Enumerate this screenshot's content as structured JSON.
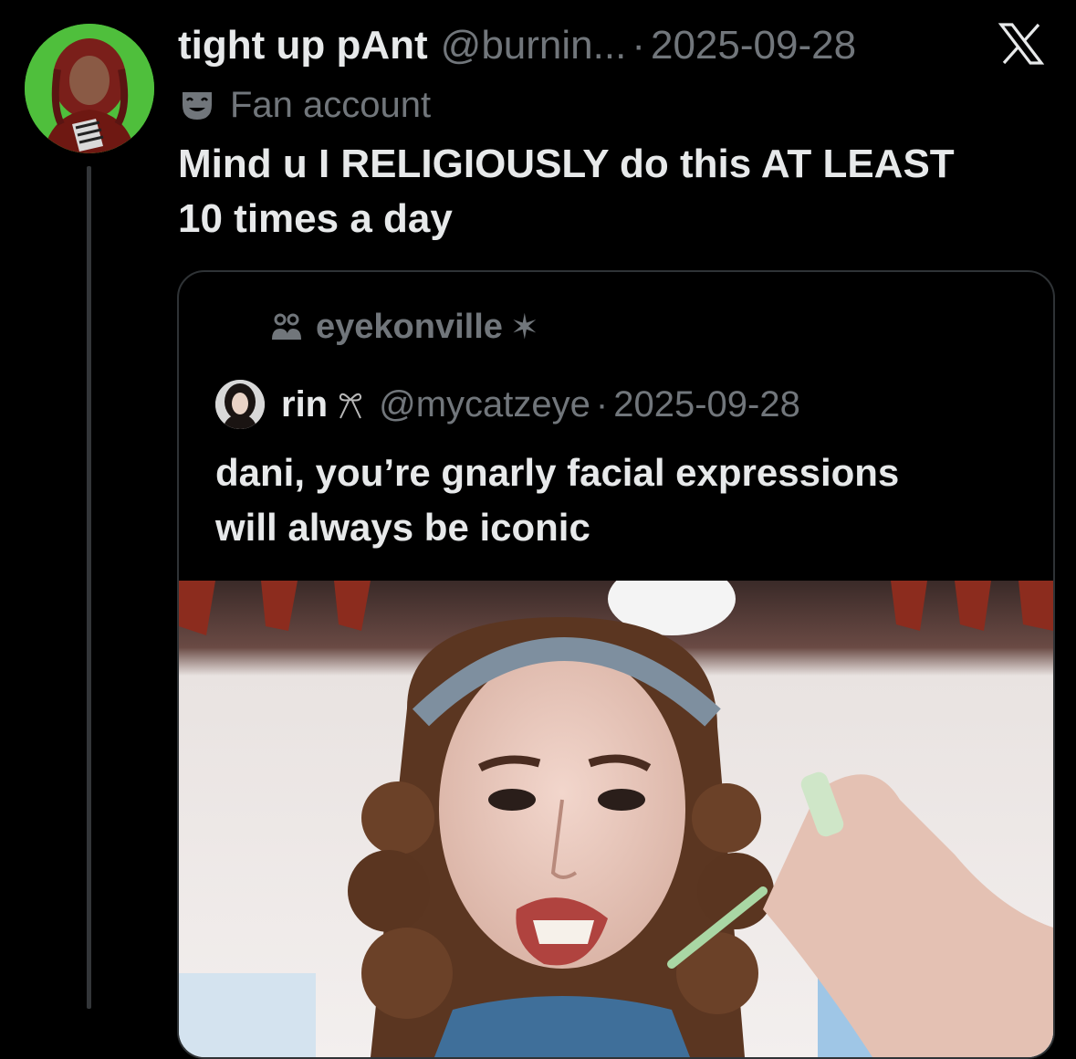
{
  "tweet": {
    "display_name": "tight up pAnt",
    "handle": "@burnin...",
    "separator": "·",
    "date": "2025-09-28",
    "label": "Fan account",
    "text_line1": "Mind u I RELIGIOUSLY do this AT LEAST",
    "text_line2": "10 times a day"
  },
  "quote": {
    "community": "eyekonville",
    "community_suffix": "✶",
    "display_name": "rin",
    "handle": "@mycatzeye",
    "separator": "·",
    "date": "2025-09-28",
    "text_line1": "dani, you’re gnarly facial expressions",
    "text_line2": "will always be iconic"
  },
  "icons": {
    "platform": "x-logo-icon",
    "label": "theater-mask-icon",
    "community": "community-people-icon",
    "name_emoji": "ribbon-bow-icon"
  },
  "colors": {
    "background": "#000000",
    "text_primary": "#e7e9ea",
    "text_secondary": "#71767b",
    "border": "#2f3336",
    "avatar_bg": "#49b83a"
  }
}
